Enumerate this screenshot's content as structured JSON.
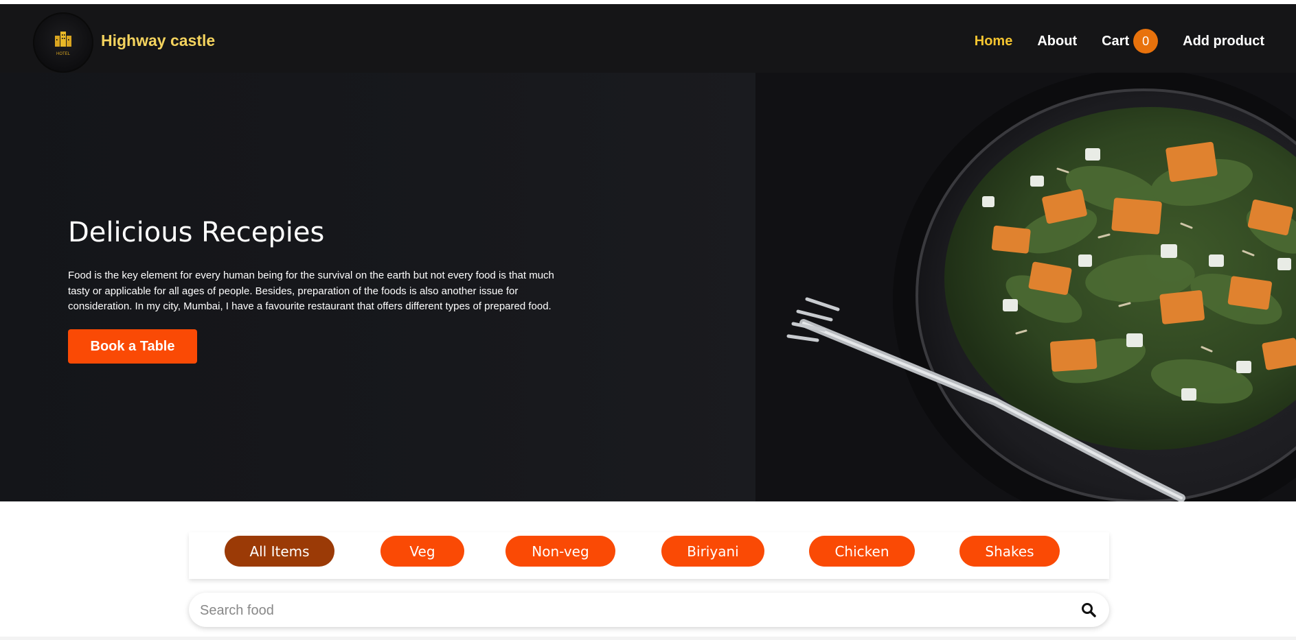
{
  "header": {
    "brand": "Highway castle",
    "logo_text": "HOTEL",
    "nav": {
      "home": "Home",
      "about": "About",
      "cart": "Cart",
      "cart_count": "0",
      "add_product": "Add product"
    }
  },
  "hero": {
    "title": "Delicious Recepies",
    "description": "Food is the key element for every human being for the survival on the earth but not every food is that much tasty or applicable for all ages of people. Besides, preparation of the foods is also another issue for consideration. In my city, Mumbai, I have a favourite restaurant that offers different types of prepared food.",
    "button": "Book a Table"
  },
  "filters": {
    "items": [
      {
        "label": "All Items",
        "active": true
      },
      {
        "label": "Veg",
        "active": false
      },
      {
        "label": "Non-veg",
        "active": false
      },
      {
        "label": "Biriyani",
        "active": false
      },
      {
        "label": "Chicken",
        "active": false
      },
      {
        "label": "Shakes",
        "active": false
      }
    ]
  },
  "search": {
    "placeholder": "Search food",
    "icon": "search-icon"
  },
  "colors": {
    "accent": "#fa4a05",
    "active_chip": "#9b3a06",
    "brand": "#f4d35e",
    "nav_active": "#f4c430",
    "badge": "#e8720c",
    "header_bg": "#151517"
  }
}
